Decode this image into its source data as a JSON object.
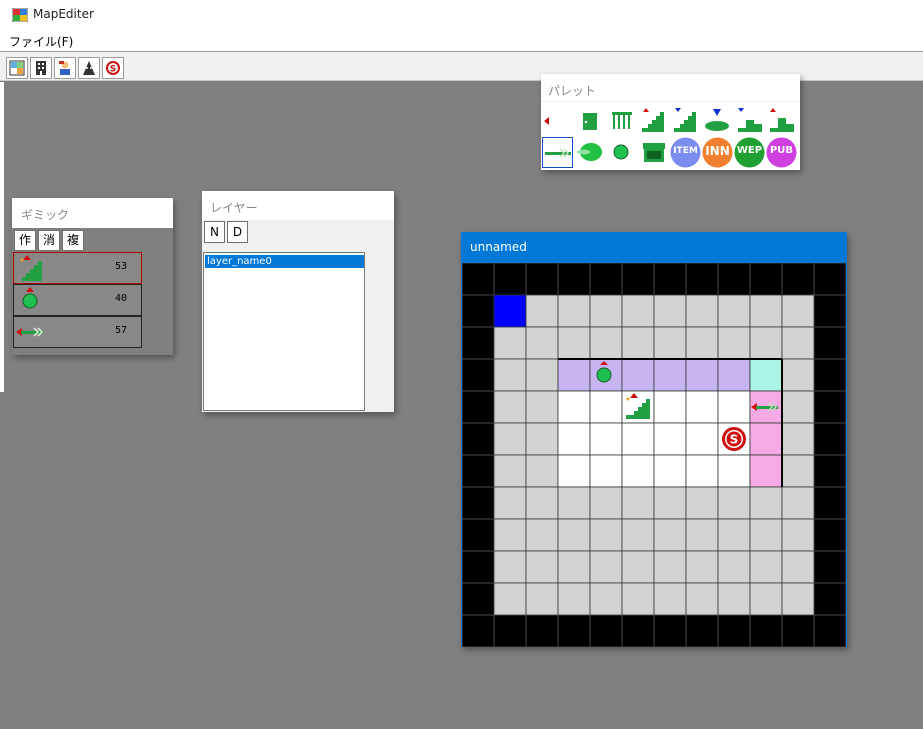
{
  "window": {
    "title": "MapEditer"
  },
  "menu": {
    "file": "ファイル(F)"
  },
  "toolbar": {
    "buttons": [
      {
        "name": "map-icon"
      },
      {
        "name": "building-icon"
      },
      {
        "name": "character-icon"
      },
      {
        "name": "monster-icon"
      },
      {
        "name": "stop-icon"
      }
    ]
  },
  "gimmick": {
    "title": "ギミック",
    "buttons": [
      "作",
      "消",
      "複"
    ],
    "items": [
      {
        "icon": "stairs-up-icon",
        "value": "53"
      },
      {
        "icon": "green-ball-icon",
        "value": "40"
      },
      {
        "icon": "arrow-icon",
        "value": "57"
      }
    ]
  },
  "layer": {
    "title": "レイヤー",
    "buttons": [
      "N",
      "D"
    ],
    "items": [
      "layer_name0"
    ]
  },
  "palette": {
    "title": "パレット",
    "labels": {
      "item": "ITEM",
      "inn": "INN",
      "wep": "WEP",
      "pub": "PUB"
    }
  },
  "map": {
    "title": "unnamed",
    "colors": {
      "black": "#000000",
      "gray": "#d3d3d3",
      "white": "#ffffff",
      "blue": "#0000ff",
      "purple": "#c8b4f0",
      "aqua": "#aaf5e6",
      "pink": "#f5aae6"
    },
    "rows": [
      "KKKKKKKKKKKK",
      "KBGGGGGGGGGK",
      "KGGGGGGGGGGK",
      "KGGPPPPPPAGK",
      "KGGWWWWWWIGK",
      "KGGWWWWWWIGK",
      "KGGWWWWWWIGK",
      "KGGGGGGGGGGK",
      "KGGGGGGGGGGK",
      "KGGGGGGGGGGK",
      "KGGGGGGGGGGK",
      "KKKKKKKKKKKK"
    ],
    "objects": [
      {
        "type": "green-ball",
        "row": 3,
        "col": 4
      },
      {
        "type": "stairs-up",
        "row": 4,
        "col": 5
      },
      {
        "type": "arrow",
        "row": 4,
        "col": 9
      },
      {
        "type": "stop",
        "row": 5,
        "col": 8
      }
    ]
  }
}
